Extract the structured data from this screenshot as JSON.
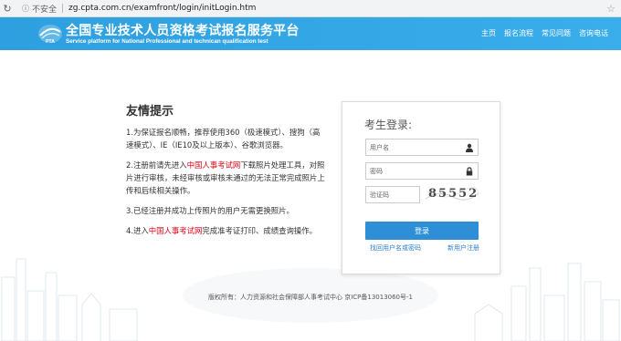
{
  "browser": {
    "secure_label": "不安全",
    "url": "zg.cpta.com.cn/examfront/login/initLogin.htm"
  },
  "header": {
    "title_cn": "全国专业技术人员资格考试报名服务平台",
    "title_en": "Service platform for National Professional and technican qualification test",
    "logo_text": "PTA",
    "nav": [
      "主页",
      "报名流程",
      "常见问题",
      "咨询电话"
    ]
  },
  "tips": {
    "heading": "友情提示",
    "items": [
      {
        "text": "1.为保证报名顺畅，推荐使用360（极速模式）、搜狗（高速模式）、IE（IE10及以上版本）、谷歌浏览器。"
      },
      {
        "pre": "2.注册前请先进入",
        "link": "中国人事考试网",
        "post": "下载照片处理工具，对照片进行审核，未经审核或审核未通过的无法正常完成照片上传和后续相关操作。"
      },
      {
        "text": "3.已经注册并成功上传照片的用户无需更换照片。"
      },
      {
        "pre": "4.进入",
        "link": "中国人事考试网",
        "post": "完成准考证打印、成绩查询操作。"
      }
    ]
  },
  "login": {
    "title": "考生登录:",
    "username_placeholder": "用户名",
    "password_placeholder": "密码",
    "captcha_placeholder": "验证码",
    "captcha_text": "85552",
    "submit_label": "登录",
    "forgot_label": "找回用户名或密码",
    "register_label": "新用户注册"
  },
  "footer": {
    "copyright": "版权所有：人力资源和社会保障部人事考试中心 京ICP备13013060号-1"
  },
  "colors": {
    "header_bg": "#2fa5e4",
    "button_bg": "#2f8fd6",
    "link_red": "#e60012",
    "link_blue": "#2f7fcf"
  }
}
